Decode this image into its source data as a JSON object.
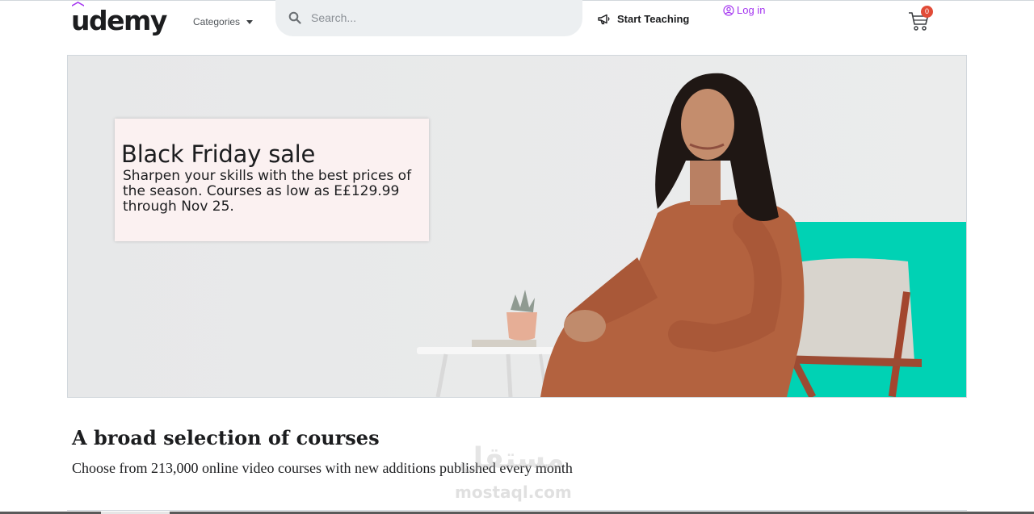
{
  "header": {
    "logo_text": "udemy",
    "categories_label": "Categories",
    "search_placeholder": "Search...",
    "start_teaching_label": "Start Teaching",
    "login_label": "Log in",
    "cart_count": "0"
  },
  "hero": {
    "title": "Black Friday sale",
    "text": "Sharpen your skills with the best prices of the season. Courses as low as E£129.99 through Nov 25."
  },
  "section": {
    "title": "A broad selection of courses",
    "subtitle": "Choose from 213,000 online video courses with new additions published every month"
  },
  "watermark": {
    "arabic": "مستقل",
    "latin": "mostaql.com"
  },
  "colors": {
    "brand_purple": "#a435f0",
    "hero_background": "#e8e9ea",
    "hero_accent_teal": "#00d2b4",
    "badge_red": "#e14b37"
  },
  "icons": {
    "search": "search-icon",
    "megaphone": "megaphone-icon",
    "user": "user-circle-icon",
    "cart": "cart-icon",
    "caret": "caret-down-icon"
  }
}
